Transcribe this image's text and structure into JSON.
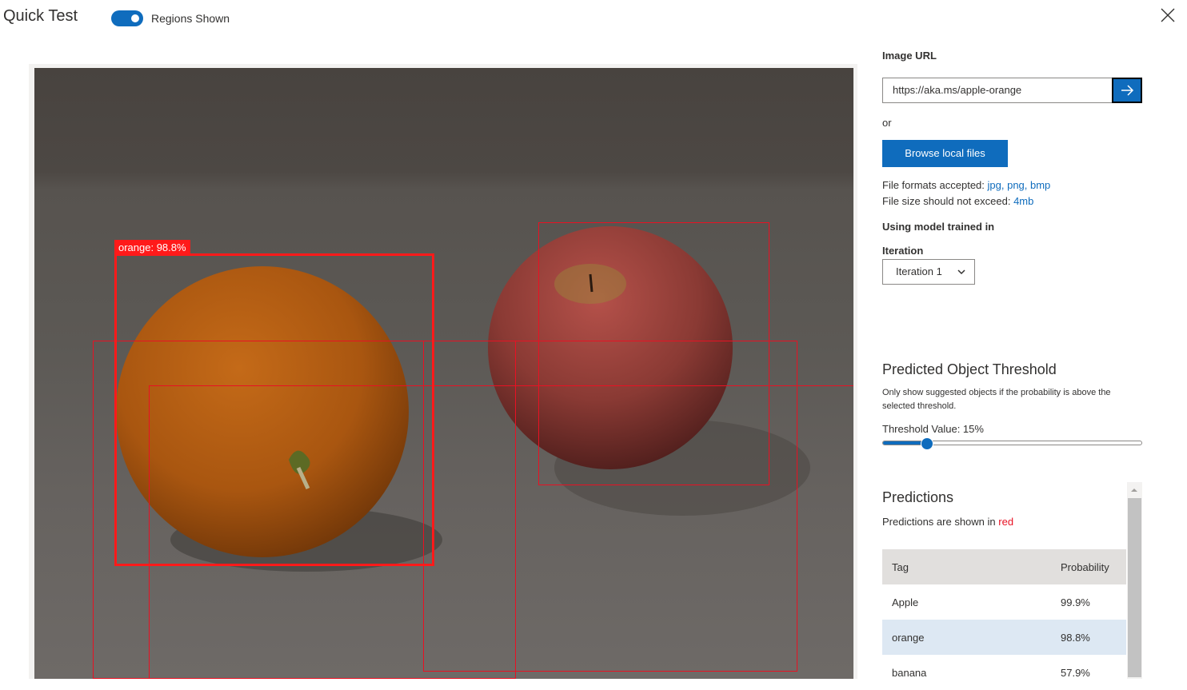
{
  "header": {
    "title": "Quick Test",
    "toggle_label": "Regions Shown",
    "toggle_on": true,
    "close_icon": "close-icon"
  },
  "image": {
    "regions": [
      {
        "label": "orange: 98.8%",
        "primary": true
      }
    ]
  },
  "panel": {
    "image_url_label": "Image URL",
    "image_url_value": "https://aka.ms/apple-orange",
    "go_icon": "arrow-right-icon",
    "or_text": "or",
    "browse_label": "Browse local files",
    "formats_prefix": "File formats accepted:",
    "formats": "jpg, png, bmp",
    "size_prefix": "File size should not exceed:",
    "size": "4mb",
    "model_label": "Using model trained in",
    "iteration_label": "Iteration",
    "iteration_value": "Iteration 1"
  },
  "threshold": {
    "title": "Predicted Object Threshold",
    "description": "Only show suggested objects if the probability is above the selected threshold.",
    "value_label": "Threshold Value: 15%",
    "value": 0.15
  },
  "predictions": {
    "title": "Predictions",
    "note_prefix": "Predictions are shown in",
    "note_color_word": "red",
    "columns": [
      "Tag",
      "Probability"
    ],
    "rows": [
      {
        "tag": "Apple",
        "probability": "99.9%"
      },
      {
        "tag": "orange",
        "probability": "98.8%",
        "selected": true
      },
      {
        "tag": "banana",
        "probability": "57.9%"
      }
    ]
  },
  "colors": {
    "accent": "#0f6cbd",
    "region": "#ff1a1a",
    "link": "#0f6cbd"
  }
}
